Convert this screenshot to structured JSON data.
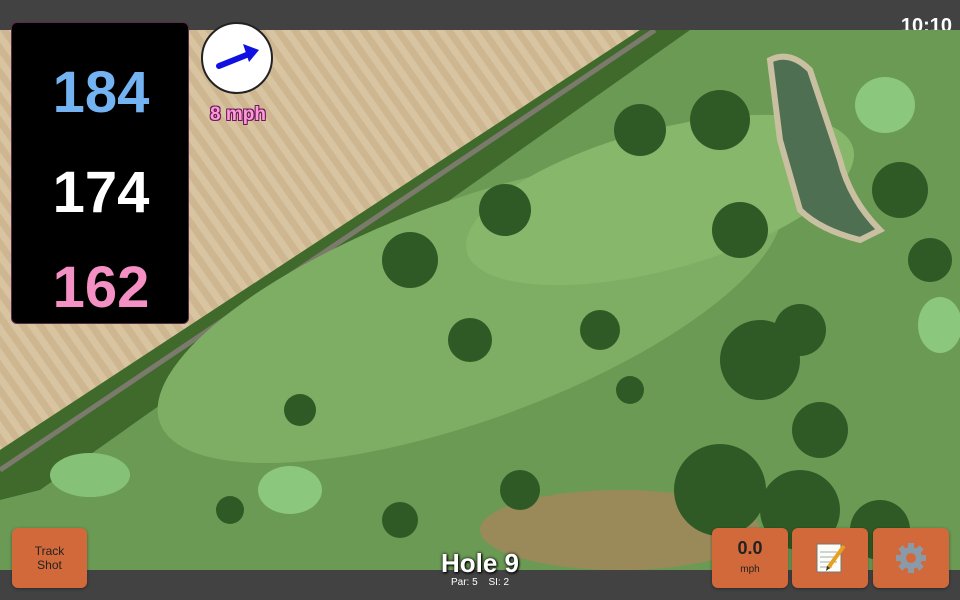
{
  "status": {
    "time": "10:10"
  },
  "yardages": {
    "back": "184",
    "middle": "174",
    "front": "162"
  },
  "wind": {
    "speed_label": "8 mph",
    "direction_icon": "arrow-right-icon"
  },
  "buttons": {
    "track_shot_line1": "Track",
    "track_shot_line2": "Shot",
    "wind_value": "0.0",
    "wind_unit": "mph",
    "notes_icon": "notepad-icon",
    "settings_icon": "gear-icon"
  },
  "hole": {
    "title": "Hole 9",
    "par_label": "Par: 5",
    "si_label": "SI: 2"
  },
  "colors": {
    "back": "#74b3f2",
    "middle": "#ffffff",
    "front": "#f590c4",
    "button": "#d2693a"
  }
}
